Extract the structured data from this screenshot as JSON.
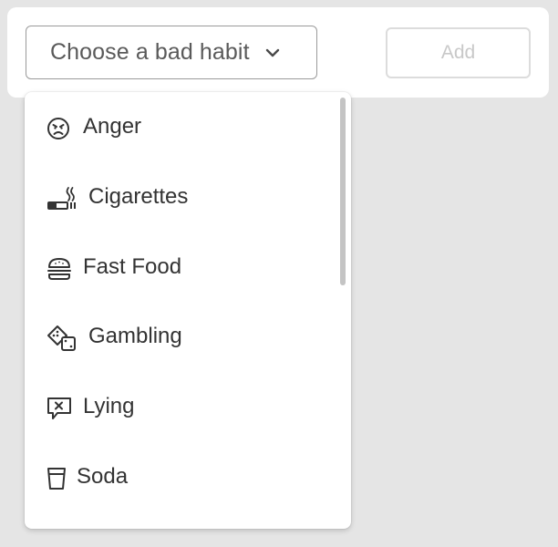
{
  "habit_select": {
    "placeholder": "Choose a bad habit",
    "chevron_icon": "chevron-down-icon"
  },
  "add_button": {
    "label": "Add",
    "disabled": true
  },
  "dropdown": {
    "items": [
      {
        "label": "Anger",
        "icon": "angry-face-icon"
      },
      {
        "label": "Cigarettes",
        "icon": "cigarette-icon"
      },
      {
        "label": "Fast Food",
        "icon": "burger-icon"
      },
      {
        "label": "Gambling",
        "icon": "dice-icon"
      },
      {
        "label": "Lying",
        "icon": "speech-bubble-x-icon"
      },
      {
        "label": "Soda",
        "icon": "cup-icon"
      }
    ]
  },
  "colors": {
    "page_background": "#e5e5e5",
    "card_background": "#ffffff",
    "text": "#333333",
    "placeholder_text": "#5a5a5a",
    "disabled_text": "#c8c8c8",
    "select_border": "#9a9a9a",
    "disabled_border": "#dcdcdc",
    "scrollbar": "#c4c4c4"
  }
}
